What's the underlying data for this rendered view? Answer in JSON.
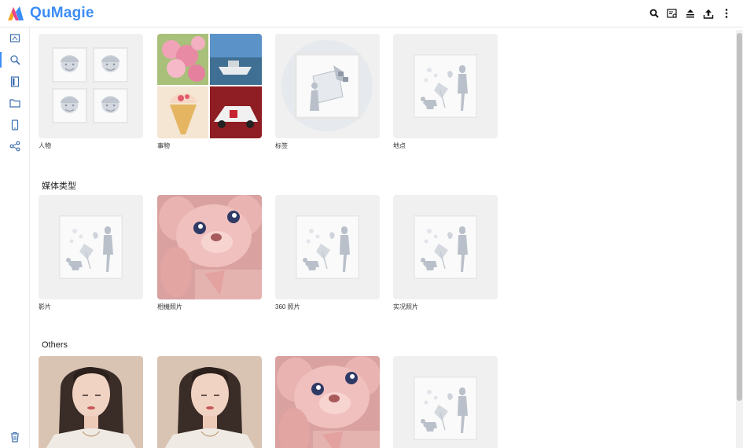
{
  "app": {
    "title": "QuMagie"
  },
  "toolbar": {
    "icons": [
      "search-icon",
      "image-search-icon",
      "upload-queue-icon",
      "upload-icon",
      "more-vertical-icon"
    ]
  },
  "sidebar": {
    "items": [
      "home-icon",
      "smart-album-icon",
      "album-icon",
      "folder-icon",
      "phone-icon",
      "share-icon"
    ],
    "bottom": "trash-icon"
  },
  "sections": {
    "top_row": [
      "人物",
      "事物",
      "标签",
      "地点"
    ],
    "media": {
      "title": "媒体类型",
      "items": [
        "影片",
        "相機照片",
        "360 照片",
        "实况照片"
      ]
    },
    "others": {
      "title": "Others"
    }
  },
  "colors": {
    "accent": "#3d8df5",
    "placeholder": "#f0f0f0"
  }
}
